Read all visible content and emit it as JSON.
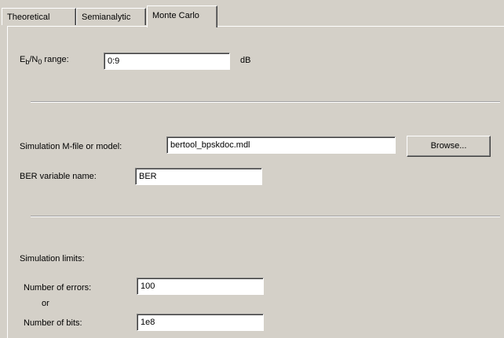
{
  "tabs": [
    {
      "label": "Theoretical"
    },
    {
      "label": "Semianalytic"
    },
    {
      "label": "Monte Carlo"
    }
  ],
  "active_tab": "Monte Carlo",
  "ebno": {
    "label_main": "E",
    "label_sub1": "b",
    "label_sep": "/N",
    "label_sub2": "0",
    "label_tail": " range:",
    "value": "0:9",
    "unit": "dB"
  },
  "simulation": {
    "model_label": "Simulation M-file or model:",
    "model_value": "bertool_bpskdoc.mdl",
    "browse_label": "Browse...",
    "ber_label": "BER variable name:",
    "ber_value": "BER"
  },
  "limits": {
    "title": "Simulation limits:",
    "errors_label": "Number of errors:",
    "errors_value": "100",
    "or_label": "or",
    "bits_label": "Number of bits:",
    "bits_value": "1e8"
  }
}
